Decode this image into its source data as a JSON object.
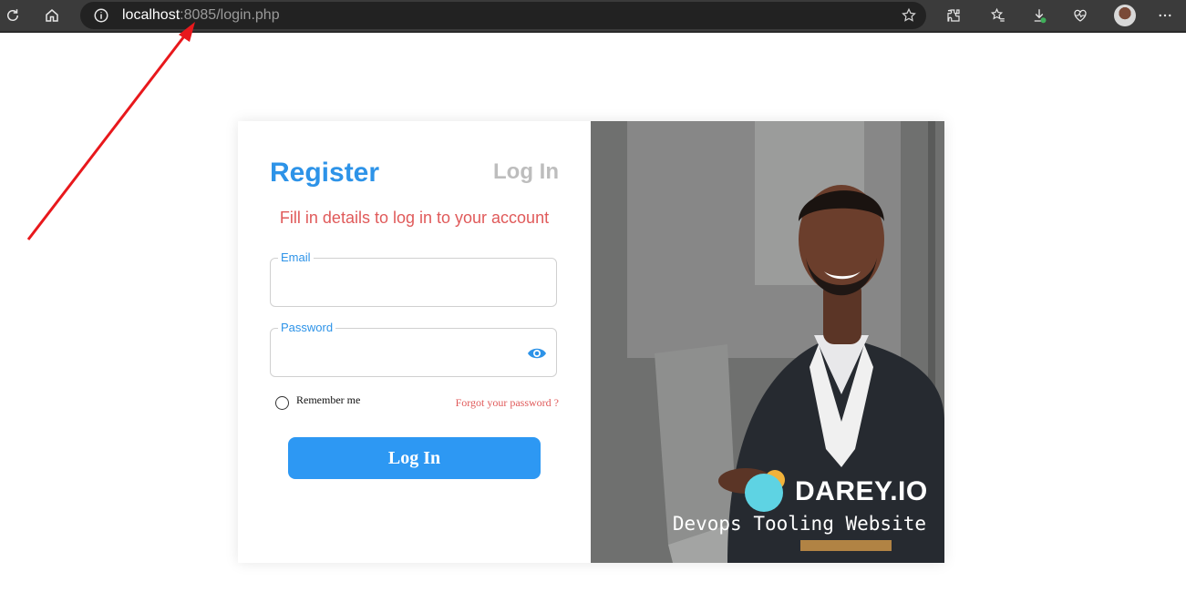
{
  "browser": {
    "url_host": "localhost",
    "url_rest": ":8085/login.php"
  },
  "tabs": {
    "register": "Register",
    "login": "Log In"
  },
  "form": {
    "subtitle": "Fill in details to log in to your account",
    "email_label": "Email",
    "password_label": "Password",
    "email_value": "",
    "password_value": "",
    "remember_label": "Remember me",
    "forgot_label": "Forgot your password ?",
    "submit_label": "Log In"
  },
  "brand": {
    "name": "DAREY.IO",
    "tagline": "Devops Tooling Website"
  },
  "colors": {
    "accent": "#2d93e8",
    "error": "#e05a5a",
    "button": "#2d98f3"
  }
}
